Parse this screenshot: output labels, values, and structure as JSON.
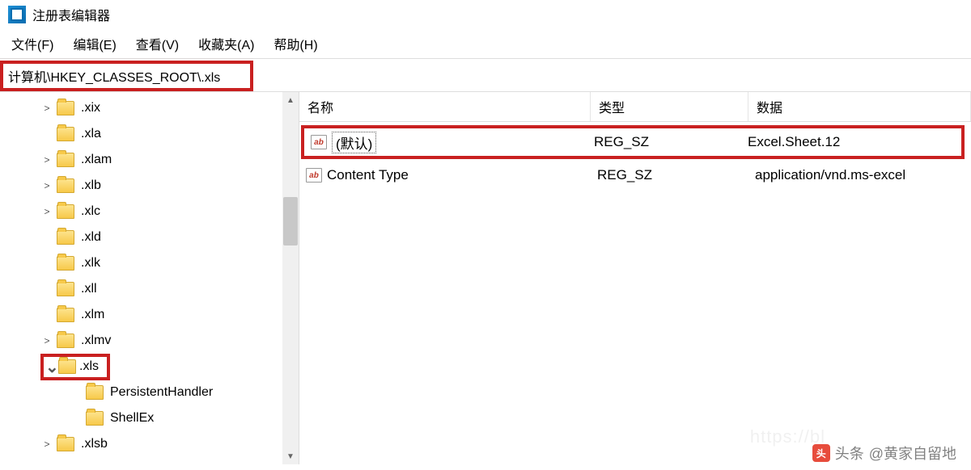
{
  "title": "注册表编辑器",
  "menubar": {
    "file": "文件(F)",
    "edit": "编辑(E)",
    "view": "查看(V)",
    "favorites": "收藏夹(A)",
    "help": "帮助(H)"
  },
  "address": "计算机\\HKEY_CLASSES_ROOT\\.xls",
  "tree": [
    {
      "indent": 1,
      "chevron": ">",
      "label": ".xix"
    },
    {
      "indent": 1,
      "chevron": "",
      "label": ".xla"
    },
    {
      "indent": 1,
      "chevron": ">",
      "label": ".xlam"
    },
    {
      "indent": 1,
      "chevron": ">",
      "label": ".xlb"
    },
    {
      "indent": 1,
      "chevron": ">",
      "label": ".xlc"
    },
    {
      "indent": 1,
      "chevron": "",
      "label": ".xld"
    },
    {
      "indent": 1,
      "chevron": "",
      "label": ".xlk"
    },
    {
      "indent": 1,
      "chevron": "",
      "label": ".xll"
    },
    {
      "indent": 1,
      "chevron": "",
      "label": ".xlm"
    },
    {
      "indent": 1,
      "chevron": ">",
      "label": ".xlmv"
    },
    {
      "indent": 1,
      "chevron": "v",
      "label": ".xls",
      "highlighted": true
    },
    {
      "indent": 2,
      "chevron": "",
      "label": "PersistentHandler"
    },
    {
      "indent": 2,
      "chevron": "",
      "label": "ShellEx"
    },
    {
      "indent": 1,
      "chevron": ">",
      "label": ".xlsb"
    }
  ],
  "list": {
    "headers": {
      "name": "名称",
      "type": "类型",
      "data": "数据"
    },
    "rows": [
      {
        "name": "(默认)",
        "type": "REG_SZ",
        "data": "Excel.Sheet.12",
        "highlighted": true,
        "dotted": true
      },
      {
        "name": "Content Type",
        "type": "REG_SZ",
        "data": "application/vnd.ms-excel"
      }
    ]
  },
  "watermark": {
    "label": "头条",
    "at": "@黄家自留地",
    "faint": "https://bl"
  }
}
